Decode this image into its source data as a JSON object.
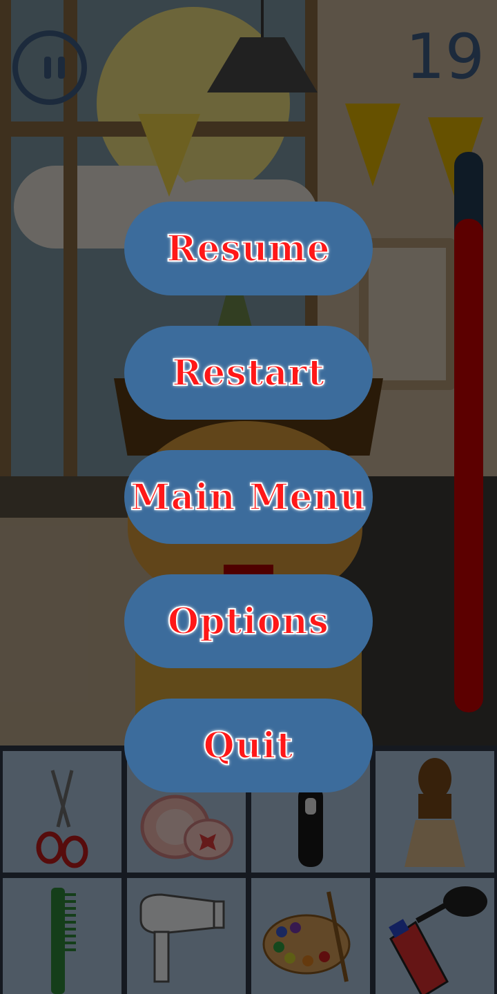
{
  "hud": {
    "score": "19",
    "pause_icon": "pause-icon",
    "meter_level": 0.88
  },
  "pause_menu": {
    "items": [
      {
        "label": "Resume"
      },
      {
        "label": "Restart"
      },
      {
        "label": "Main Menu"
      },
      {
        "label": "Options"
      },
      {
        "label": "Quit"
      }
    ]
  },
  "toolbar": {
    "tools": [
      {
        "icon": "scissors-icon"
      },
      {
        "icon": "face-powder-icon"
      },
      {
        "icon": "electric-razor-icon"
      },
      {
        "icon": "shaving-brush-icon"
      },
      {
        "icon": "comb-icon"
      },
      {
        "icon": "hair-dryer-icon"
      },
      {
        "icon": "paint-palette-icon"
      },
      {
        "icon": "spray-can-icon"
      }
    ]
  },
  "colors": {
    "menu_button": "#3c6c9c",
    "menu_text": "#ff1818",
    "meter_fill": "#5c0000",
    "hud_dark": "#1c2a3c"
  }
}
